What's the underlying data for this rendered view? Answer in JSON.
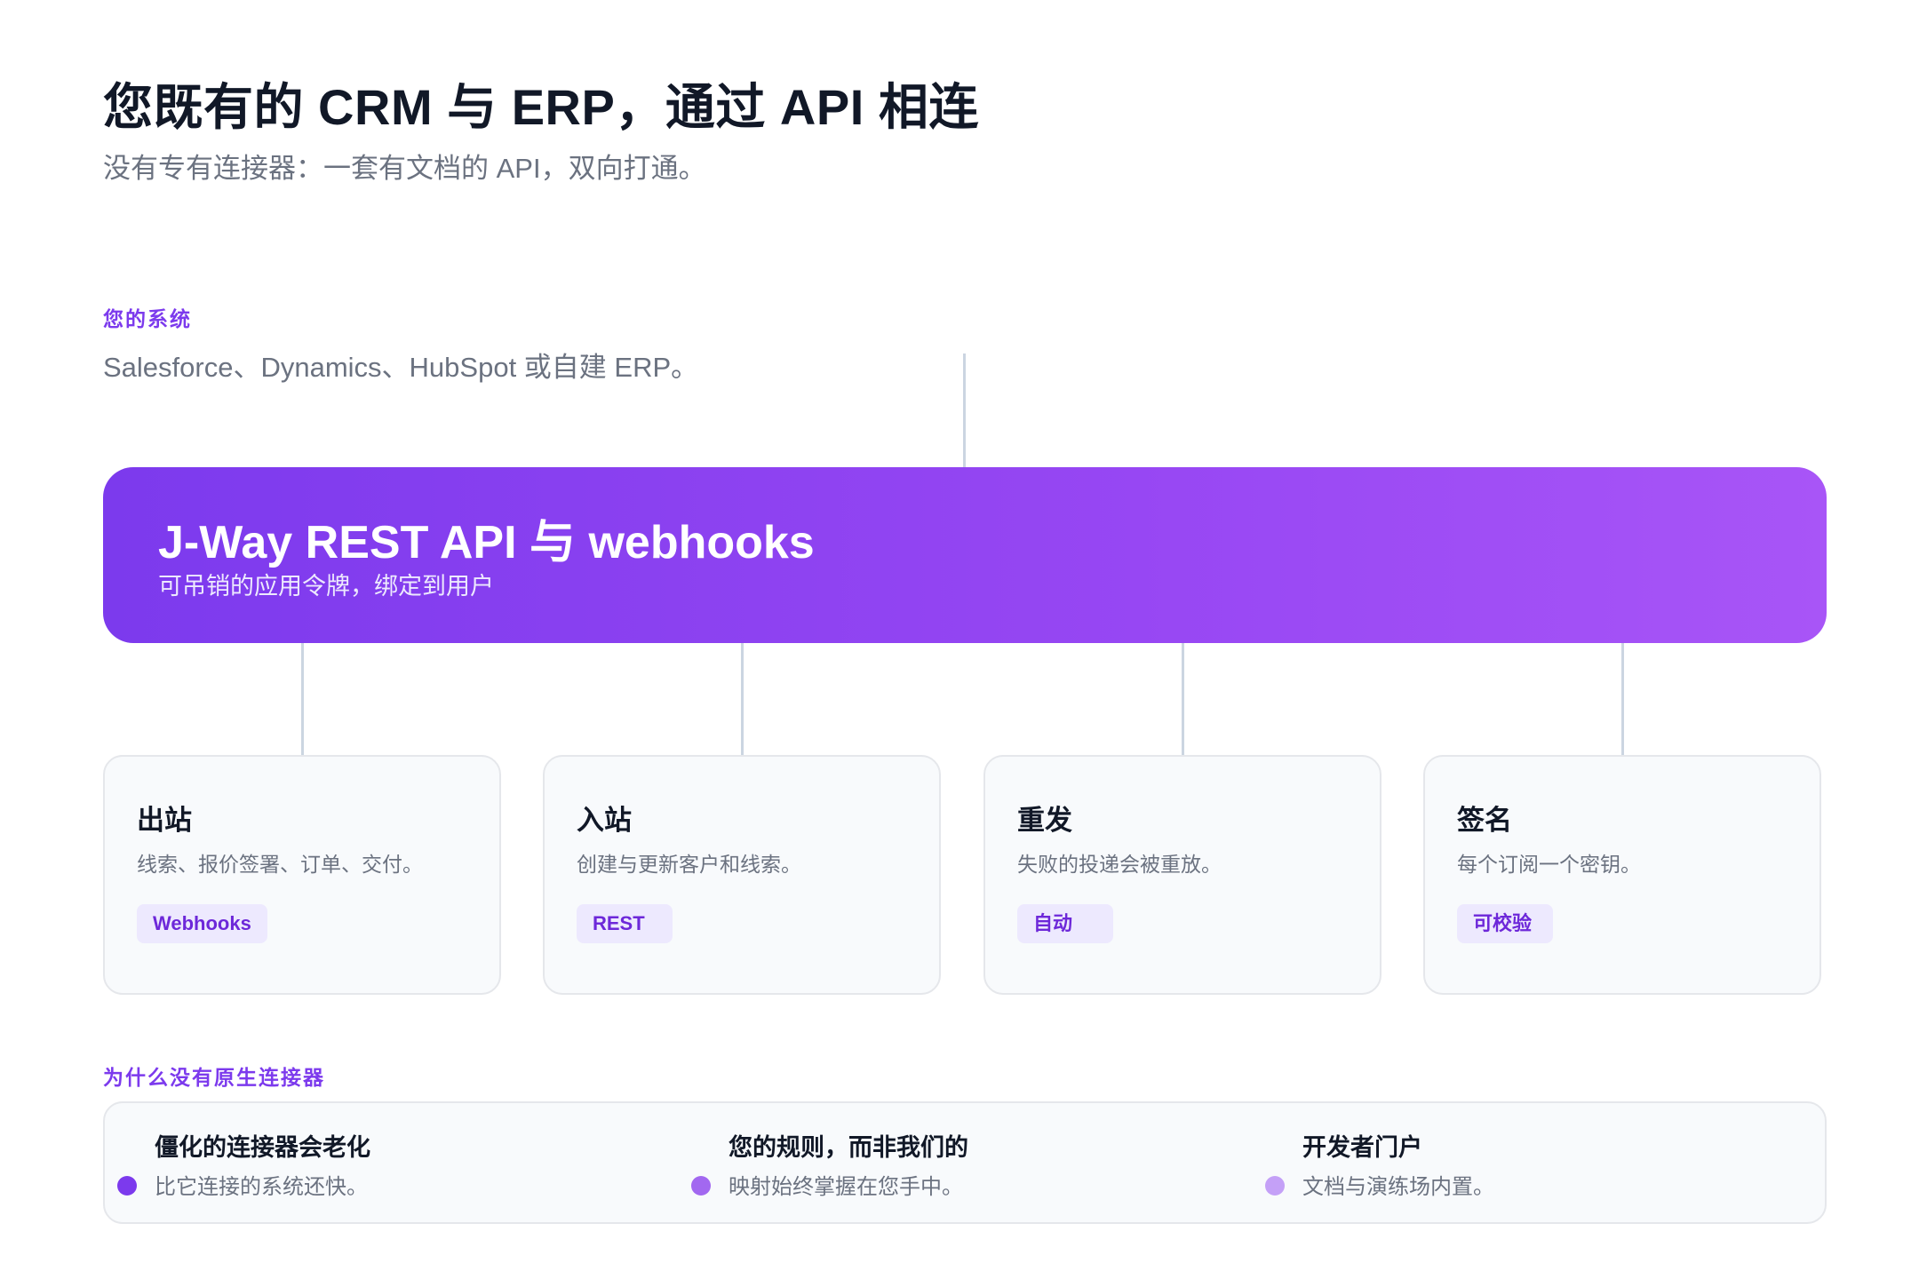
{
  "header": {
    "title": "您既有的 CRM 与 ERP，通过 API 相连",
    "subtitle": "没有专有连接器：一套有文档的 API，双向打通。"
  },
  "systems": {
    "label": "您的系统",
    "description": "Salesforce、Dynamics、HubSpot 或自建 ERP。"
  },
  "hub": {
    "title": "J-Way REST API 与 webhooks",
    "subtitle": "可吊销的应用令牌，绑定到用户"
  },
  "cards": [
    {
      "title": "出站",
      "description": "线索、报价签署、订单、交付。",
      "badge": "Webhooks"
    },
    {
      "title": "入站",
      "description": "创建与更新客户和线索。",
      "badge": "REST"
    },
    {
      "title": "重发",
      "description": "失败的投递会被重放。",
      "badge": "自动"
    },
    {
      "title": "签名",
      "description": "每个订阅一个密钥。",
      "badge": "可校验"
    }
  ],
  "why": {
    "label": "为什么没有原生连接器",
    "items": [
      {
        "title": "僵化的连接器会老化",
        "description": "比它连接的系统还快。",
        "dot_color": "#7c3aed"
      },
      {
        "title": "您的规则，而非我们的",
        "description": "映射始终掌握在您手中。",
        "dot_color": "#a268f0"
      },
      {
        "title": "开发者门户",
        "description": "文档与演练场内置。",
        "dot_color": "#c4a0f7"
      }
    ]
  }
}
